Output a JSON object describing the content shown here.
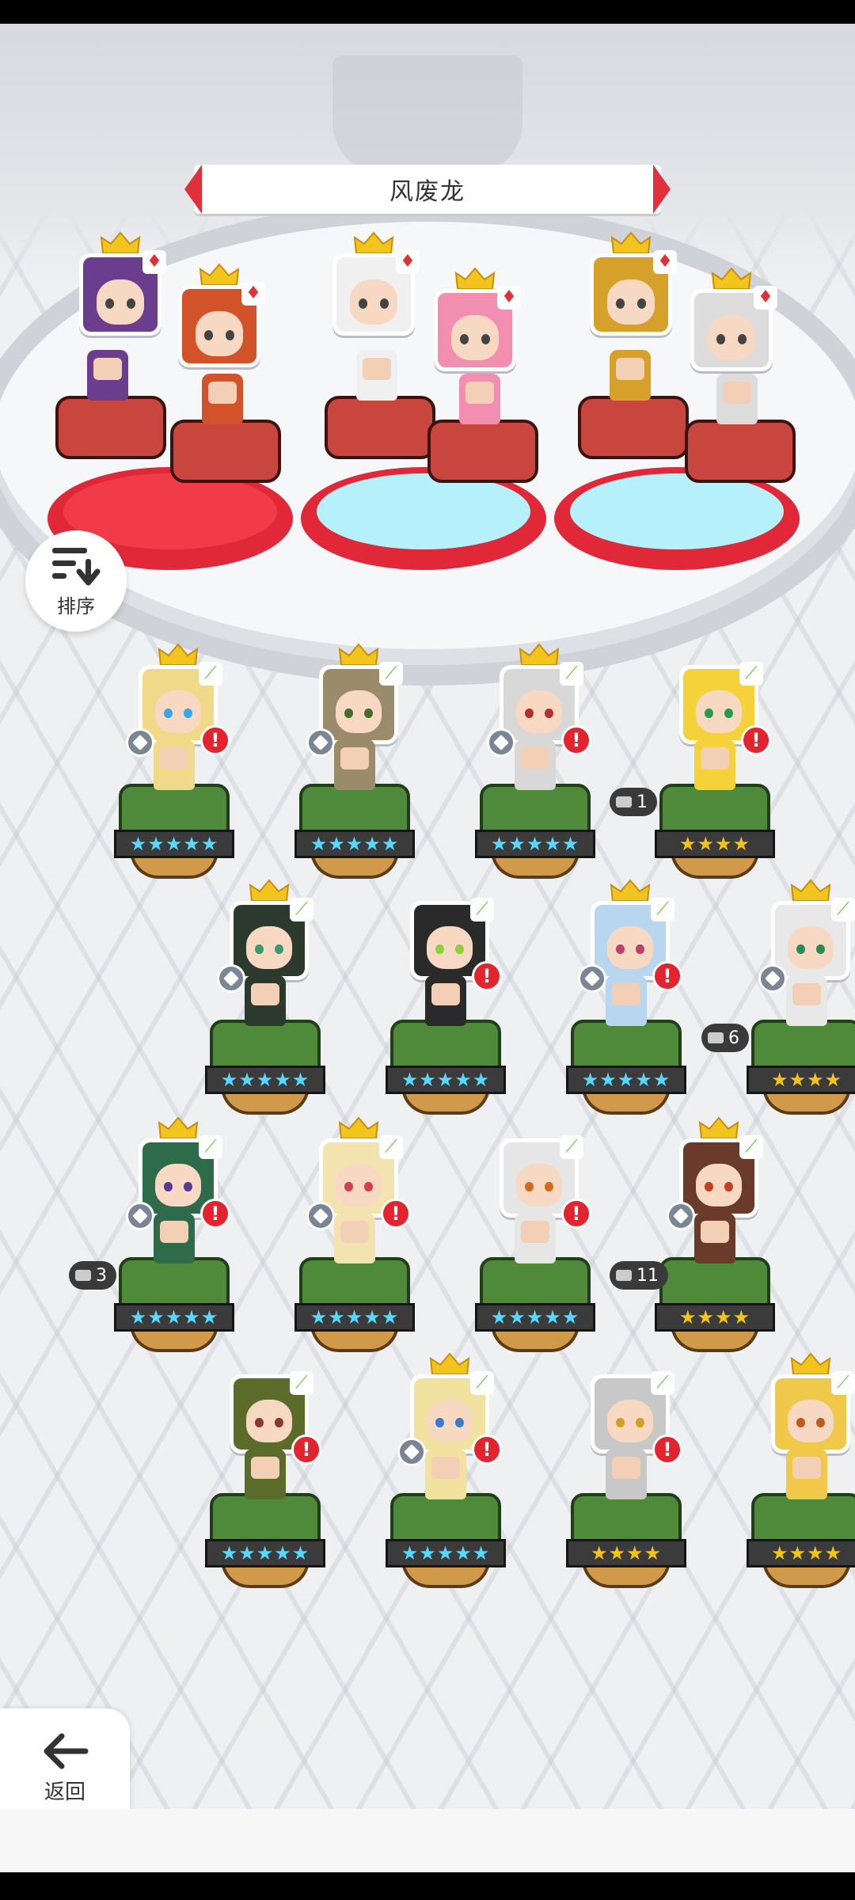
{
  "title": "风废龙",
  "sort_label": "排序",
  "back_label": "返回",
  "colors": {
    "alert": "#e3242f",
    "element_fire": "#e0303a",
    "element_wind": "#6bc23f",
    "stars_blue": "#58d7ff",
    "stars_gold": "#f3c317"
  },
  "team": [
    {
      "element": "♦",
      "crown": true,
      "hair": "#6b3d8f"
    },
    {
      "element": "♦",
      "crown": true,
      "hair": "#d2522a"
    },
    {
      "element": "♦",
      "crown": true,
      "hair": "#f0f0f0"
    },
    {
      "element": "♦",
      "crown": true,
      "hair": "#f28fb0"
    },
    {
      "element": "♦",
      "crown": true,
      "hair": "#d6a12a"
    },
    {
      "element": "♦",
      "crown": true,
      "hair": "#dcdcdc"
    }
  ],
  "roster": [
    {
      "crown": true,
      "gear": true,
      "alert": "!",
      "stars": "★★★★★",
      "tier": "blue",
      "level": "",
      "hair": "#f1d98a",
      "eye": "#3ca4e8"
    },
    {
      "crown": true,
      "gear": true,
      "alert": "",
      "stars": "★★★★★",
      "tier": "blue",
      "level": "",
      "hair": "#9a8c6b",
      "eye": "#4a6b2e"
    },
    {
      "crown": true,
      "gear": true,
      "alert": "!",
      "stars": "★★★★★",
      "tier": "blue",
      "level": "",
      "hair": "#d8d8d8",
      "eye": "#b03030"
    },
    {
      "crown": false,
      "gear": false,
      "alert": "!",
      "stars": "★★★★",
      "tier": "gold",
      "level": "1",
      "hair": "#f5d23a",
      "eye": "#2a9a4a"
    },
    {
      "crown": true,
      "gear": true,
      "alert": "",
      "stars": "★★★★★",
      "tier": "blue",
      "level": "",
      "hair": "#2c3a2e",
      "eye": "#3a9a6a"
    },
    {
      "crown": false,
      "gear": false,
      "alert": "!",
      "stars": "★★★★★",
      "tier": "blue",
      "level": "",
      "hair": "#2a2a2a",
      "eye": "#8fcf3a"
    },
    {
      "crown": true,
      "gear": true,
      "alert": "!",
      "stars": "★★★★★",
      "tier": "blue",
      "level": "",
      "hair": "#b9d6f0",
      "eye": "#c0406a"
    },
    {
      "crown": true,
      "gear": true,
      "alert": "",
      "stars": "★★★★",
      "tier": "gold",
      "level": "6",
      "hair": "#e8e8e8",
      "eye": "#2a8a5a"
    },
    {
      "crown": true,
      "gear": true,
      "alert": "!",
      "stars": "★★★★★",
      "tier": "blue",
      "level": "3",
      "hair": "#2d6b4a",
      "eye": "#5a3a8a"
    },
    {
      "crown": true,
      "gear": true,
      "alert": "!",
      "stars": "★★★★★",
      "tier": "blue",
      "level": "",
      "hair": "#f3e3b0",
      "eye": "#d04050"
    },
    {
      "crown": false,
      "gear": false,
      "alert": "!",
      "stars": "★★★★★",
      "tier": "blue",
      "level": "",
      "hair": "#e6e6e6",
      "eye": "#d06a20"
    },
    {
      "crown": true,
      "gear": true,
      "alert": "",
      "stars": "★★★★",
      "tier": "gold",
      "level": "11",
      "hair": "#6a3a2a",
      "eye": "#c04020"
    },
    {
      "crown": false,
      "gear": false,
      "alert": "!",
      "stars": "★★★★★",
      "tier": "blue",
      "level": "",
      "hair": "#5a6b2a",
      "eye": "#8a3a2a"
    },
    {
      "crown": true,
      "gear": true,
      "alert": "!",
      "stars": "★★★★★",
      "tier": "blue",
      "level": "",
      "hair": "#f2e2a0",
      "eye": "#3a7ad0"
    },
    {
      "crown": false,
      "gear": false,
      "alert": "!",
      "stars": "★★★★",
      "tier": "gold",
      "level": "",
      "hair": "#c8c8c8",
      "eye": "#d0a020"
    },
    {
      "crown": true,
      "gear": false,
      "alert": "",
      "stars": "★★★★",
      "tier": "gold",
      "level": "",
      "hair": "#f0c84a",
      "eye": "#c05a20"
    }
  ]
}
